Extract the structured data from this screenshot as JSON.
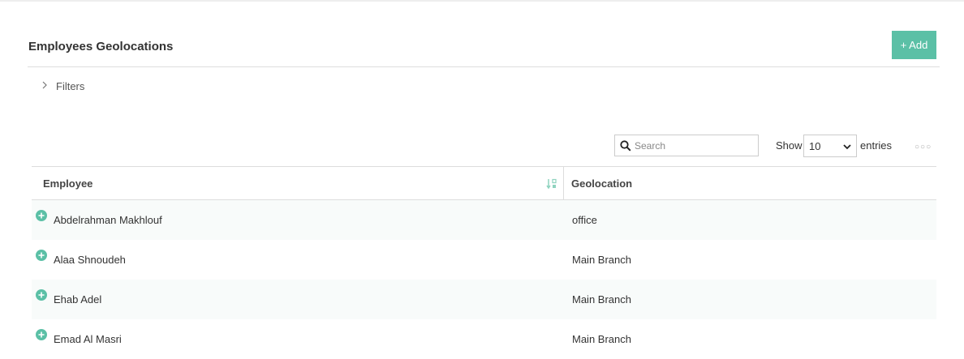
{
  "page": {
    "title": "Employees Geolocations",
    "add_label": "+ Add"
  },
  "filters": {
    "label": "Filters"
  },
  "toolbar": {
    "search_placeholder": "Search",
    "show_label": "Show",
    "page_size": "10",
    "entries_label": "entries"
  },
  "table": {
    "columns": [
      "Employee",
      "Geolocation"
    ],
    "rows": [
      {
        "employee": "Abdelrahman Makhlouf",
        "geolocation": "office"
      },
      {
        "employee": "Alaa Shnoudeh",
        "geolocation": "Main Branch"
      },
      {
        "employee": "Ehab Adel",
        "geolocation": "Main Branch"
      },
      {
        "employee": "Emad Al Masri",
        "geolocation": "Main Branch"
      }
    ]
  },
  "colors": {
    "accent": "#5bc0a6",
    "border": "#dddddd",
    "row_alt": "#f8fbfa"
  },
  "icons": {
    "filters": "chevron-right-icon",
    "search": "search-icon",
    "sort": "sort-icon",
    "expand": "plus-circle-icon",
    "select": "chevron-down-icon"
  }
}
